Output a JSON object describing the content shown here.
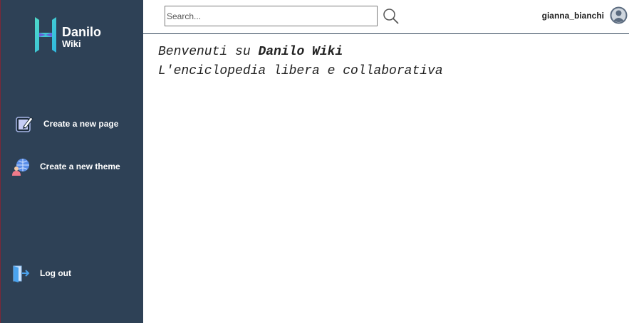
{
  "app": {
    "logo_title": "Danilo",
    "logo_subtitle": "Wiki"
  },
  "sidebar": {
    "items": [
      {
        "label": "Create a new page",
        "icon": "edit-page-icon"
      },
      {
        "label": "Create a new theme",
        "icon": "theme-globe-icon"
      },
      {
        "label": "Log out",
        "icon": "logout-door-icon"
      }
    ]
  },
  "header": {
    "search_placeholder": "Search...",
    "search_icon": "search-icon",
    "username": "gianna_bianchi",
    "avatar_icon": "user-avatar-icon"
  },
  "main": {
    "welcome_prefix": "Benvenuti su ",
    "welcome_site": "Danilo Wiki",
    "tagline": "L'enciclopedia libera e collaborativa"
  },
  "colors": {
    "sidebar_bg": "#2e4156",
    "logo_accent": "#3fe0c0",
    "text_dark": "#222222"
  }
}
